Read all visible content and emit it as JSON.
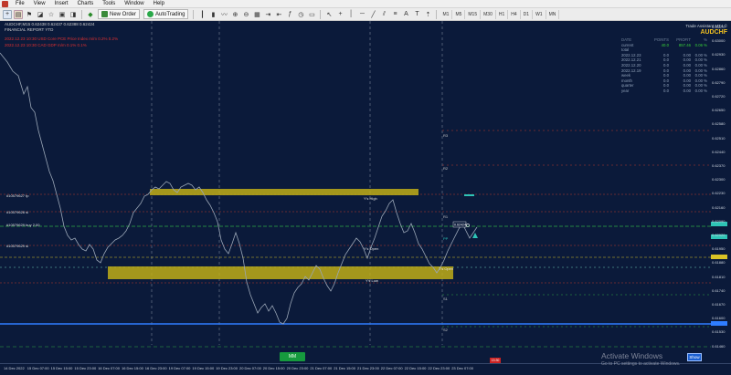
{
  "menu": [
    "File",
    "View",
    "Insert",
    "Charts",
    "Tools",
    "Window",
    "Help"
  ],
  "toolbar": {
    "new_order": "New Order",
    "autotrading": "AutoTrading",
    "timeframes": [
      "M1",
      "M5",
      "M15",
      "M30",
      "H1",
      "H4",
      "D1",
      "W1",
      "MN"
    ]
  },
  "chart": {
    "header_line": "AUDCHF,M15  0.62438 0.62437 0.62388 0.62424",
    "report_title": "FINANCIAL REPORT YTD",
    "report_lines": [
      "2022.12.23 10:30  USD Core PCE Price Index m/m   0.2%   0.2%",
      "2022.12.23 10:30  CAD GDP m/m                    0.1%   0.1%"
    ],
    "left_labels": [
      "#10579627 tp",
      "#10579628 sl",
      "#10579629 buy 2.00",
      "#10579629 sl"
    ],
    "level_labels": {
      "yh": "Y's High",
      "yopen": "Y's Open",
      "ylow": "Y's Low",
      "topen": "T's Open",
      "r3": "R3",
      "r2": "R2",
      "r1": "R1",
      "pp": "PP",
      "s1": "S1",
      "s2": "S2"
    },
    "price_labels": [
      "0.63070",
      "0.63000",
      "0.62930",
      "0.62860",
      "0.62790",
      "0.62720",
      "0.62650",
      "0.62580",
      "0.62510",
      "0.62440",
      "0.62370",
      "0.62300",
      "0.62230",
      "0.62160",
      "0.62090",
      "0.62020",
      "0.61950",
      "0.61880",
      "0.61810",
      "0.61740",
      "0.61670",
      "0.61600",
      "0.61530",
      "0.61460"
    ],
    "time_labels": [
      "14 Dec 2022",
      "15 Dec 07:00",
      "15 Dec 15:00",
      "15 Dec 23:00",
      "16 Dec 07:00",
      "16 Dec 15:00",
      "16 Dec 23:00",
      "19 Dec 07:00",
      "19 Dec 15:00",
      "19 Dec 23:00",
      "20 Dec 07:00",
      "20 Dec 15:00",
      "20 Dec 23:00",
      "21 Dec 07:00",
      "21 Dec 15:00",
      "21 Dec 23:00",
      "22 Dec 07:00",
      "22 Dec 15:00",
      "22 Dec 23:00",
      "23 Dec 07:00"
    ],
    "bid_tag": "0.62424",
    "colors": {
      "background": "#0b1a3a",
      "price_line": "#9aa6b6",
      "zone": "#bfae18",
      "blue_level": "#2f7dff",
      "green_level": "#2faa44",
      "red_level": "#c0392b",
      "pivot_cyan": "#2ec4b6"
    }
  },
  "trade_assistant": {
    "title": "Trade Assistant MT4 ©",
    "symbol": "AUDCHF",
    "columns": [
      "DATE",
      "POINTS",
      "PROFIT",
      "%"
    ],
    "current": [
      "current",
      "40.0",
      "857.46",
      "0.06 %"
    ],
    "rows": [
      [
        "total",
        "",
        "",
        ""
      ],
      [
        "2022.12.23",
        "0.0",
        "0.00",
        "0.00 %"
      ],
      [
        "2022.12.21",
        "0.0",
        "0.00",
        "0.00 %"
      ],
      [
        "2022.12.20",
        "0.0",
        "0.00",
        "0.00 %"
      ],
      [
        "2022.12.19",
        "0.0",
        "0.00",
        "0.00 %"
      ],
      [
        "week",
        "0.0",
        "0.00",
        "0.00 %"
      ],
      [
        "month",
        "0.0",
        "0.00",
        "0.00 %"
      ],
      [
        "quarter",
        "0.0",
        "0.00",
        "0.00 %"
      ],
      [
        "year",
        "0.0",
        "0.00",
        "0.00 %"
      ]
    ]
  },
  "mm_button": "MM",
  "show_button": "Show",
  "red_tag": "13:30",
  "watermark": {
    "line1": "Activate Windows",
    "line2": "Go to PC settings to activate Windows."
  }
}
